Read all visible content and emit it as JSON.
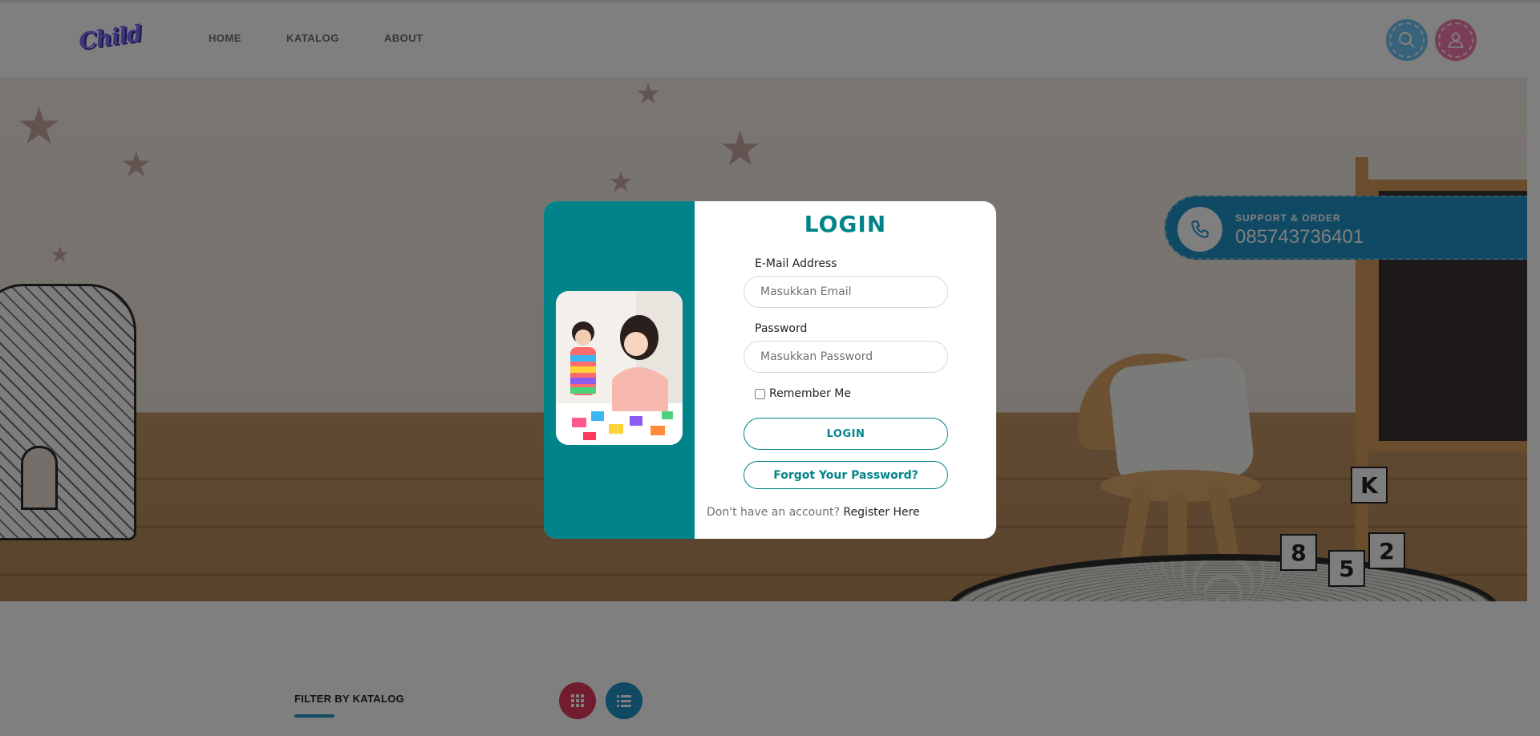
{
  "header": {
    "logo_text": "Child",
    "nav": [
      "HOME",
      "KATALOG",
      "ABOUT"
    ],
    "search_icon": "search-icon",
    "user_icon": "user-icon"
  },
  "support": {
    "label": "SUPPORT & ORDER",
    "phone": "085743736401",
    "icon": "phone-icon"
  },
  "login_modal": {
    "title": "LOGIN",
    "email_label": "E-Mail Address",
    "email_placeholder": "Masukkan Email",
    "password_label": "Password",
    "password_placeholder": "Masukkan Password",
    "remember_label": "Remember Me",
    "login_button": "LOGIN",
    "forgot_button": "Forgot Your Password?",
    "register_prompt": "Don't have an account?",
    "register_link": "Register Here"
  },
  "filter": {
    "title": "FILTER BY KATALOG",
    "grid_icon": "grid-icon",
    "list_icon": "list-icon"
  },
  "colors": {
    "teal": "#00848a",
    "blue": "#1e93c6",
    "pink": "#f27bb0",
    "red": "#e2395f",
    "sky": "#6ec4f2"
  }
}
